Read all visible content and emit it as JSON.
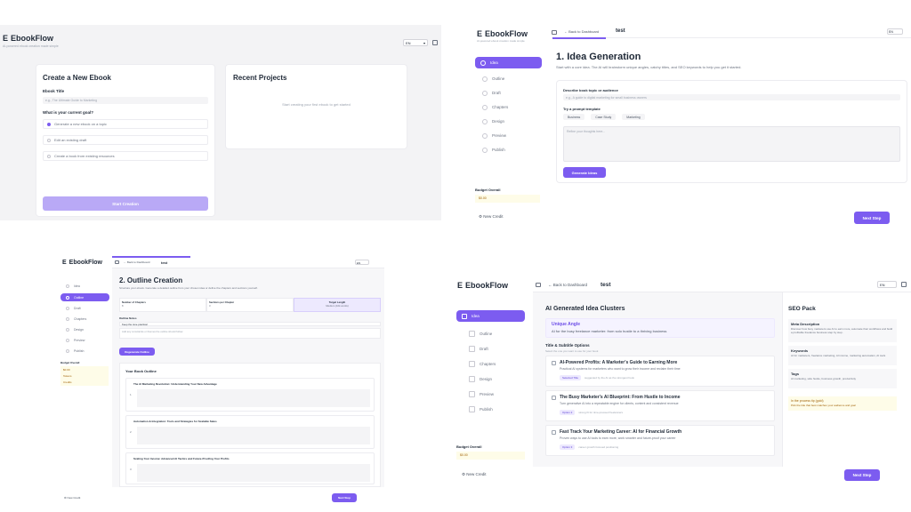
{
  "app": {
    "name": "EbookFlow",
    "logo_glyph": "E",
    "accent": "#7c5cf0"
  },
  "q1": {
    "subtitle": "AI-powered ebook creation made simple",
    "lang": "EN",
    "create_title": "Create a New Ebook",
    "ebook_title_label": "Ebook Title",
    "ebook_title_placeholder": "e.g., The Ultimate Guide to Marketing",
    "question": "What is your current goal?",
    "options": [
      "Generate a new ebook on a topic",
      "Edit an existing draft",
      "Create a book from existing resources"
    ],
    "start_button": "Start Creation",
    "recent_title": "Recent Projects",
    "recent_empty": "Start creating your first ebook to get started"
  },
  "q2": {
    "subtitle": "AI-powered ebook creation made simple",
    "back": "Back to Dashboard",
    "project": "test",
    "lang": "EN",
    "nav": [
      "Idea",
      "Outline",
      "Draft",
      "Chapters",
      "Design",
      "Preview",
      "Publish"
    ],
    "budget_title": "Budget Overall",
    "budget_value": "$0.00",
    "new_credit": "New Credit",
    "heading": "1. Idea Generation",
    "description": "Start with a core idea. The AI will brainstorm unique angles, catchy titles, and SEO keywords to help you get it started.",
    "field_label": "Describe book topic or audience",
    "field_placeholder": "e.g., A guide to digital marketing for small business owners",
    "prompts_label": "Try a prompt template",
    "prompts": [
      "Business",
      "Case Study",
      "Marketing"
    ],
    "textarea_placeholder": "Refine your thoughts here...",
    "generate_button": "Generate Ideas",
    "next_button": "Next Step"
  },
  "q3": {
    "back": "Back to Dashboard",
    "project": "test",
    "lang": "EN",
    "nav": [
      "Idea",
      "Outline",
      "Draft",
      "Chapters",
      "Design",
      "Preview",
      "Publish"
    ],
    "heading": "2. Outline Creation",
    "description": "Structure your ebook. Generate a detailed outline from your chosen idea or define the chapters and sections yourself.",
    "options": [
      {
        "label": "Number of Chapters",
        "value": "8"
      },
      {
        "label": "Sections per Chapter",
        "value": "3"
      },
      {
        "label": "Target Length",
        "value": "Medium (10k words)"
      }
    ],
    "notes_label": "Outline Notes",
    "notes_value": "Keep the tone practical",
    "notes_hint": "Add any constraints or themes the outline should follow",
    "generate_button": "Regenerate Outline",
    "outline_title": "Your Book Outline",
    "chapters": [
      "The AI Marketing Revolution: Understanding Your New Advantage",
      "Automation & Integration: Tools and Strategies for Scalable Sales",
      "Scaling Your Income: Advanced AI Tactics and Future-Proofing Your Profits"
    ],
    "budget_title": "Budget Overall",
    "budget_lines": [
      "$0.00",
      "Tokens",
      "Credits"
    ],
    "new_credit": "New Credit",
    "next_button": "Next Step"
  },
  "q4": {
    "back": "Back to Dashboard",
    "project": "test",
    "lang": "EN",
    "nav": [
      "Idea",
      "Outline",
      "Draft",
      "Chapters",
      "Design",
      "Preview",
      "Publish"
    ],
    "budget_title": "Budget Overall",
    "budget_value": "$0.00",
    "new_credit": "New Credit",
    "heading": "AI Generated Idea Clusters",
    "unique_angle_title": "Unique Angle",
    "unique_angle_text": "AI for the busy freelance marketer: from solo hustle to a thriving business",
    "titles_heading": "Title & Subtitle Options",
    "titles_sub": "Select the one you want to use for your book",
    "titles": [
      {
        "title": "AI-Powered Profits: A Marketer's Guide to Earning More",
        "sub": "Practical AI systems for marketers who want to grow their income and reclaim their time",
        "tag": "Selected Title",
        "note": "suggested by the AI as the strongest hook"
      },
      {
        "title": "The Busy Marketer's AI Blueprint: From Hustle to Income",
        "sub": "Turn generative AI into a repeatable engine for clients, content and consistent revenue",
        "tag": "Option 2",
        "note": "strong fit for time-pressed freelancers"
      },
      {
        "title": "Fast Track Your Marketing Career: AI for Financial Growth",
        "sub": "Proven ways to use AI tools to earn more, work smarter and future-proof your career",
        "tag": "Option 3",
        "note": "career growth focused positioning"
      }
    ],
    "seo_title": "SEO Pack",
    "seo": [
      {
        "label": "Meta Description",
        "text": "Discover how busy marketers use AI to earn more, automate their workflows and build a profitable freelance business step by step."
      },
      {
        "label": "Keywords",
        "text": "AI for marketers, freelance marketing, AI income, marketing automation, AI tools"
      },
      {
        "label": "Tags",
        "text": "AI marketing, side hustle, business growth, productivity"
      }
    ],
    "tip_title": "In the process tip (gold)",
    "tip_text": "Pick the title that best matches your audience and goal",
    "next_button": "Next Step"
  }
}
